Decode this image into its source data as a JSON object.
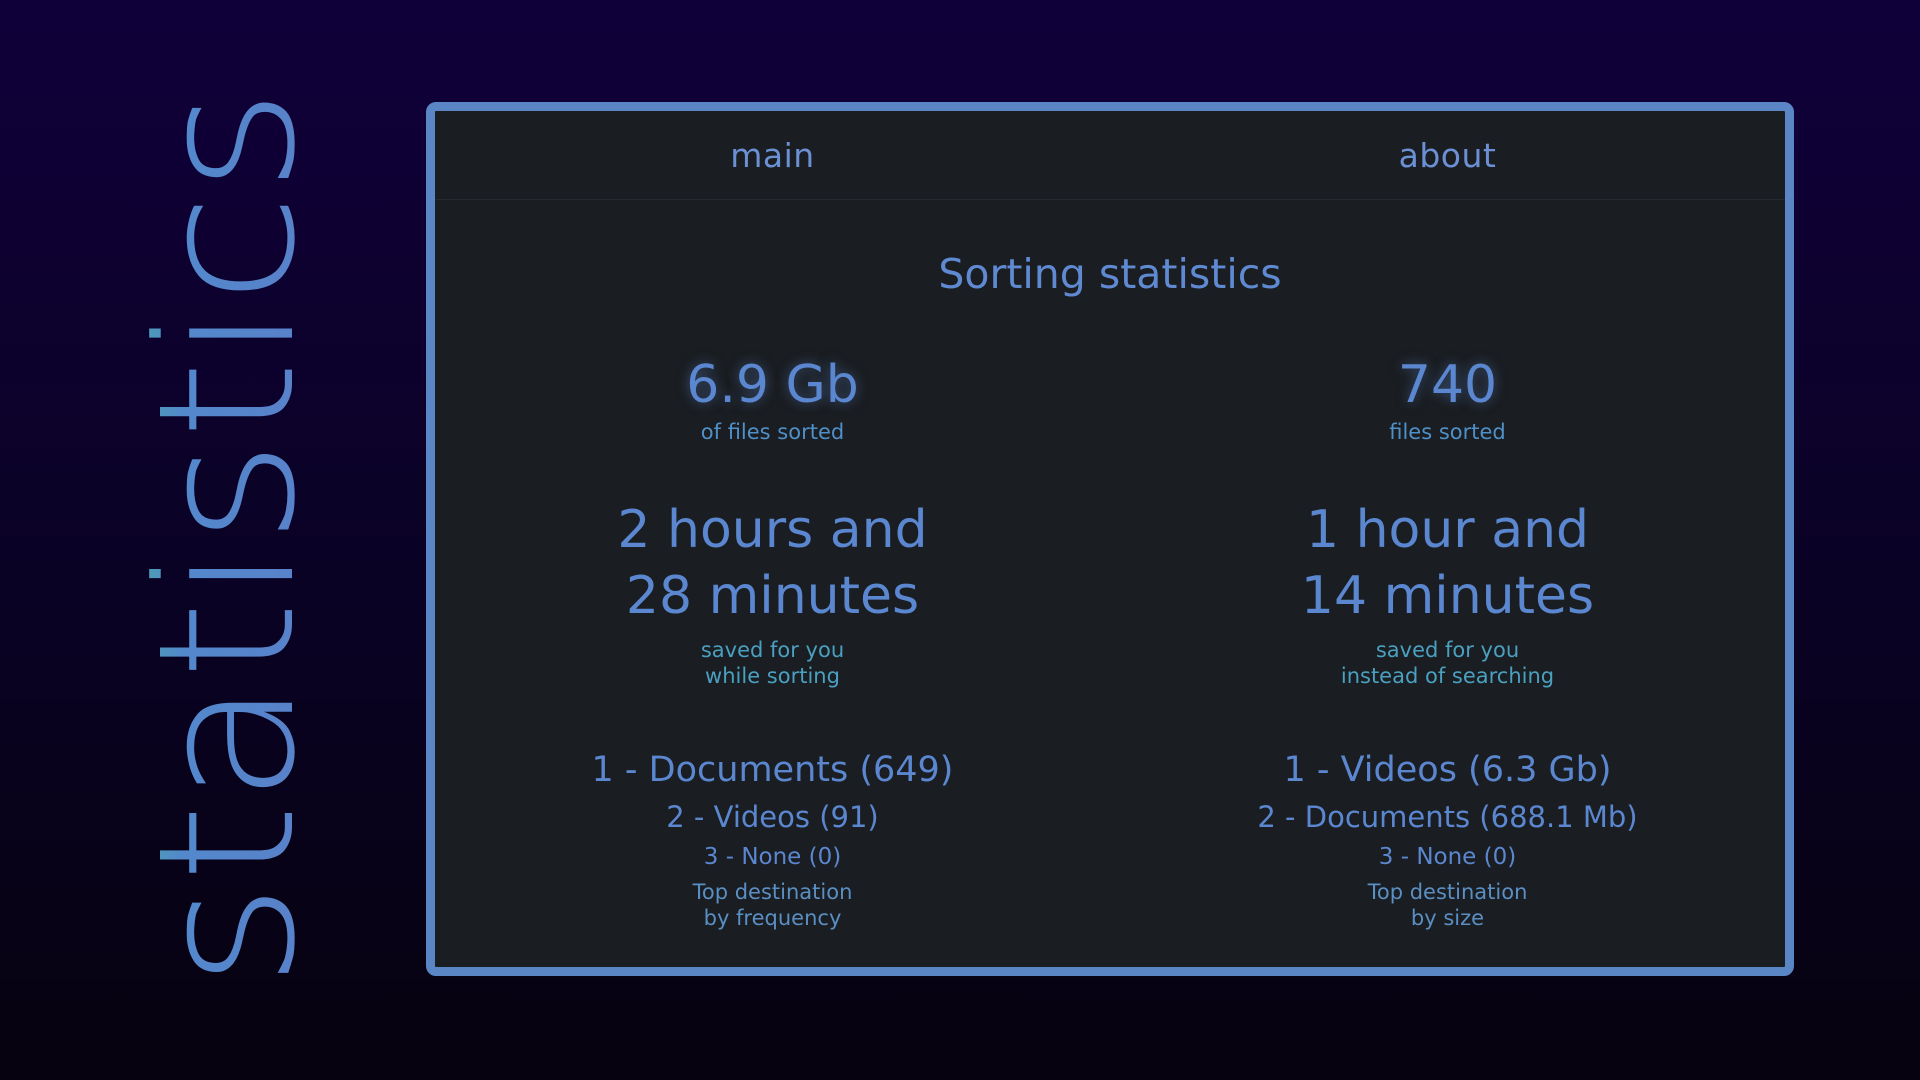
{
  "side_title": "statistics",
  "tabs": {
    "main": "main",
    "about": "about"
  },
  "page_title": "Sorting statistics",
  "left": {
    "value": "6.9 Gb",
    "value_caption": "of files sorted",
    "time_line1": "2 hours and",
    "time_line2": "28 minutes",
    "time_caption1": "saved for you",
    "time_caption2": "while sorting",
    "rank1": "1 - Documents (649)",
    "rank2": "2 - Videos (91)",
    "rank3": "3 - None (0)",
    "rank_caption1": "Top destination",
    "rank_caption2": "by frequency"
  },
  "right": {
    "value": "740",
    "value_caption": "files sorted",
    "time_line1": "1 hour and",
    "time_line2": "14 minutes",
    "time_caption1": "saved for you",
    "time_caption2": "instead of searching",
    "rank1": "1 - Videos (6.3 Gb)",
    "rank2": "2 - Documents (688.1 Mb)",
    "rank3": "3 - None (0)",
    "rank_caption1": "Top destination",
    "rank_caption2": "by size"
  },
  "colors": {
    "accent": "#5a86c6",
    "background_top": "#10003a",
    "panel": "#1a1d21",
    "title_gradient_start": "#48a9a6",
    "title_gradient_end": "#5a7fc8"
  }
}
